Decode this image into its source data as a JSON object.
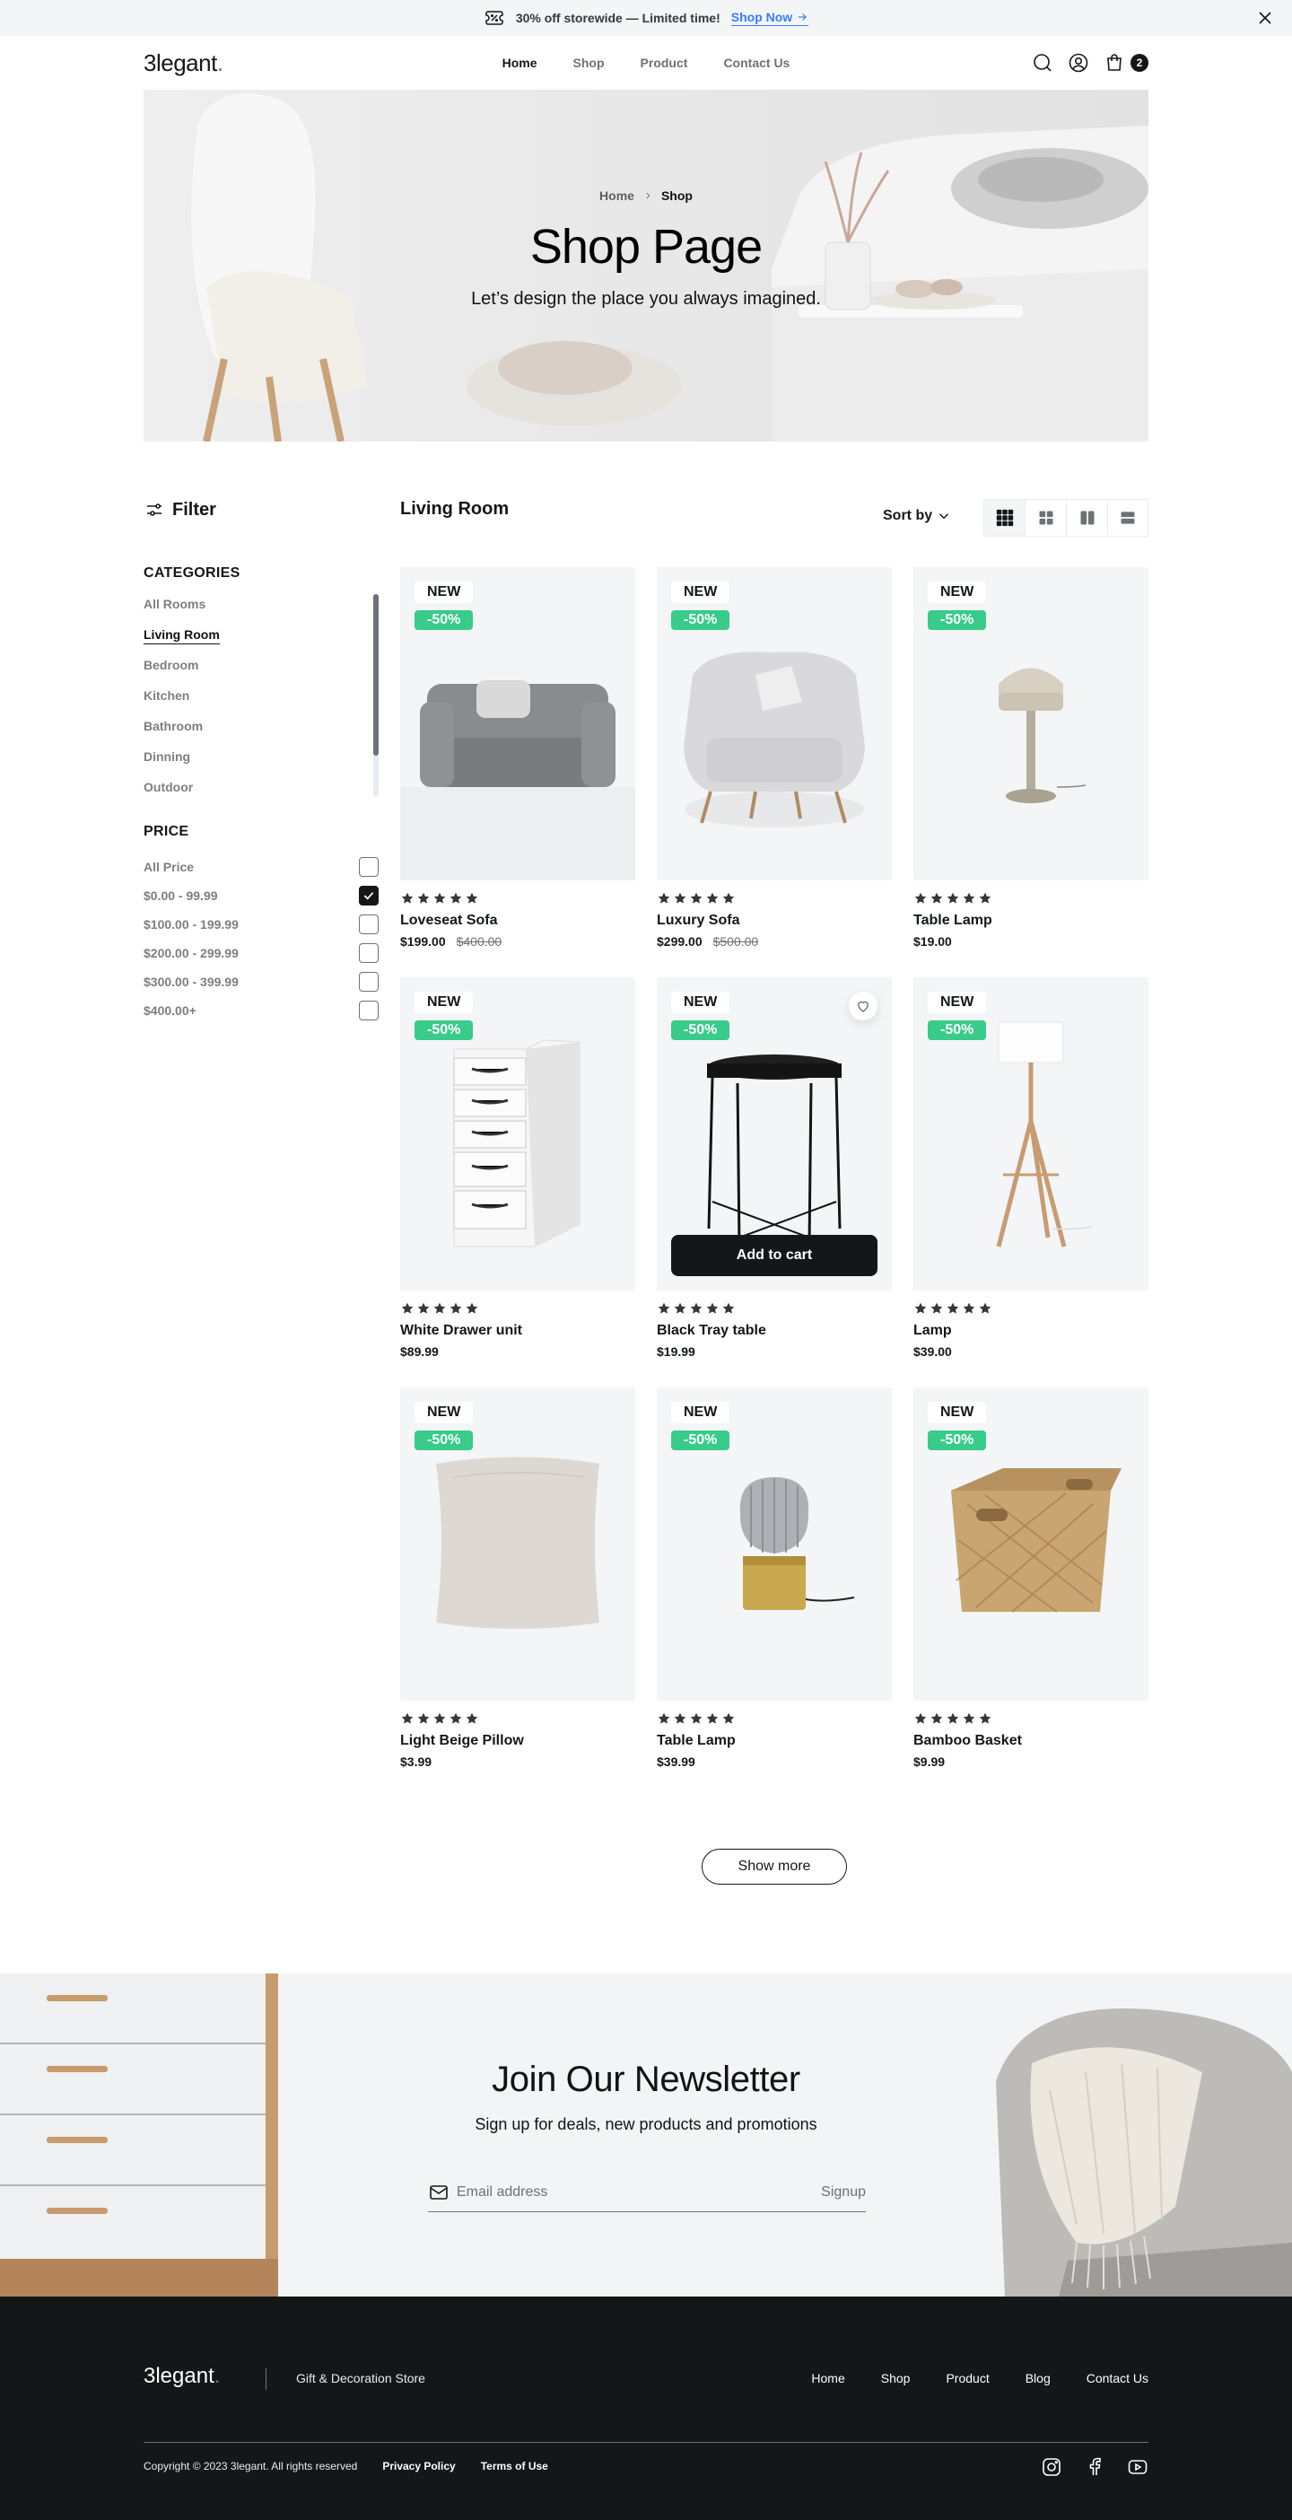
{
  "banner": {
    "text": "30% off storewide — Limited time!",
    "link": "Shop Now",
    "icon": "ticket-percent-icon"
  },
  "nav": {
    "logo": "3legant",
    "logo_dot": ".",
    "menu": [
      "Home",
      "Shop",
      "Product",
      "Contact Us"
    ],
    "active": "Home",
    "cart_count": "2"
  },
  "hero": {
    "breadcrumb": [
      "Home",
      "Shop"
    ],
    "title": "Shop Page",
    "subtitle": "Let’s design the place you always imagined."
  },
  "sidebar": {
    "filter_label": "Filter",
    "categories_title": "CATEGORIES",
    "categories": [
      "All Rooms",
      "Living Room",
      "Bedroom",
      "Kitchen",
      "Bathroom",
      "Dinning",
      "Outdoor"
    ],
    "active_category": "Living Room",
    "price_title": "PRICE",
    "prices": [
      {
        "label": "All Price",
        "checked": false
      },
      {
        "label": "$0.00 - 99.99",
        "checked": true
      },
      {
        "label": "$100.00 - 199.99",
        "checked": false
      },
      {
        "label": "$200.00 - 299.99",
        "checked": false
      },
      {
        "label": "$300.00 - 399.99",
        "checked": false
      },
      {
        "label": "$400.00+",
        "checked": false
      }
    ]
  },
  "main": {
    "title": "Living Room",
    "sort_label": "Sort by",
    "view_modes": [
      "grid-3-icon",
      "grid-4-icon",
      "columns-2-icon",
      "list-rows-icon"
    ],
    "products": [
      {
        "name": "Loveseat Sofa",
        "price": "$199.00",
        "old_price": "$400.00",
        "new": "NEW",
        "discount": "-50%",
        "rating": 5
      },
      {
        "name": "Luxury Sofa",
        "price": "$299.00",
        "old_price": "$500.00",
        "new": "NEW",
        "discount": "-50%",
        "rating": 5
      },
      {
        "name": "Table Lamp",
        "price": "$19.00",
        "old_price": "",
        "new": "NEW",
        "discount": "-50%",
        "rating": 5
      },
      {
        "name": "White Drawer unit",
        "price": "$89.99",
        "old_price": "",
        "new": "NEW",
        "discount": "-50%",
        "rating": 5
      },
      {
        "name": "Black Tray table",
        "price": "$19.99",
        "old_price": "",
        "new": "NEW",
        "discount": "-50%",
        "rating": 5,
        "add_to_cart": "Add to cart"
      },
      {
        "name": "Lamp",
        "price": "$39.00",
        "old_price": "",
        "new": "NEW",
        "discount": "-50%",
        "rating": 5
      },
      {
        "name": "Light Beige Pillow",
        "price": "$3.99",
        "old_price": "",
        "new": "NEW",
        "discount": "-50%",
        "rating": 5
      },
      {
        "name": "Table Lamp",
        "price": "$39.99",
        "old_price": "",
        "new": "NEW",
        "discount": "-50%",
        "rating": 5
      },
      {
        "name": "Bamboo Basket",
        "price": "$9.99",
        "old_price": "",
        "new": "NEW",
        "discount": "-50%",
        "rating": 5
      }
    ],
    "show_more": "Show more"
  },
  "newsletter": {
    "title": "Join Our Newsletter",
    "subtitle": "Sign up for deals, new products and promotions",
    "placeholder": "Email address",
    "button": "Signup"
  },
  "footer": {
    "logo": "3legant",
    "logo_dot": ".",
    "tagline": "Gift & Decoration Store",
    "links": [
      "Home",
      "Shop",
      "Product",
      "Blog",
      "Contact Us"
    ],
    "copyright": "Copyright © 2023 3legant. All rights reserved",
    "privacy": "Privacy Policy",
    "terms": "Terms of Use",
    "social": [
      "instagram-icon",
      "facebook-icon",
      "youtube-icon"
    ]
  },
  "colors": {
    "accent_green": "#38CB89",
    "link_blue": "#377DFF",
    "dark": "#141718",
    "light_bg": "#F3F5F7"
  }
}
